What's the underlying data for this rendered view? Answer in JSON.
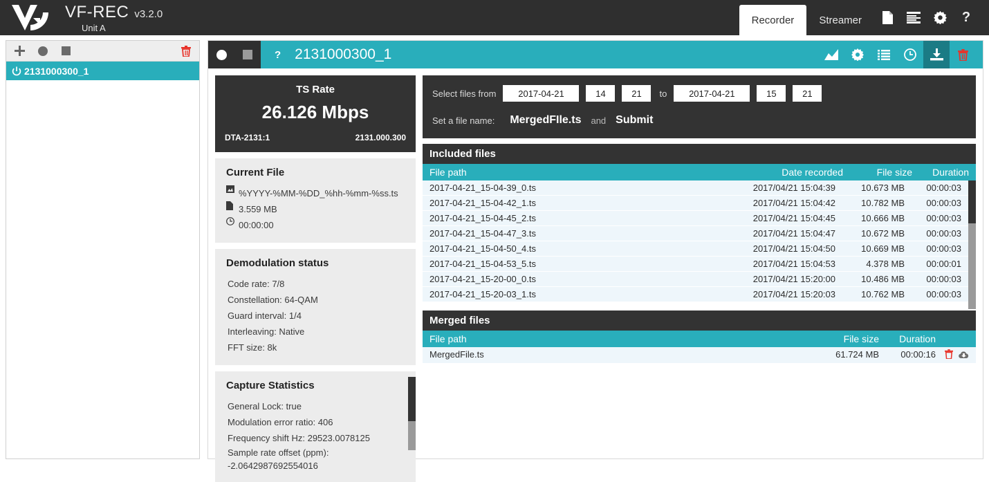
{
  "header": {
    "logo_icon": "va-logo-icon",
    "app_name": "VF-REC",
    "version": "v3.2.0",
    "unit": "Unit A",
    "tabs": [
      {
        "label": "Recorder",
        "active": true
      },
      {
        "label": "Streamer",
        "active": false
      }
    ],
    "icons": [
      {
        "name": "document-icon",
        "glyph": "📄"
      },
      {
        "name": "logs-icon",
        "glyph": "☰"
      },
      {
        "name": "gear-icon",
        "glyph": "⚙"
      },
      {
        "name": "help-icon",
        "glyph": "?"
      }
    ]
  },
  "sidebar": {
    "toolbar": [
      {
        "name": "add-channel-button",
        "glyph": "+"
      },
      {
        "name": "record-button",
        "glyph": "●"
      },
      {
        "name": "stop-button",
        "glyph": "■"
      }
    ],
    "delete_label": "delete-channel-button",
    "channels": [
      {
        "label": "2131000300_1",
        "selected": true
      }
    ]
  },
  "panel_header": {
    "record_icon": "record-icon",
    "stop_icon": "stop-icon",
    "help_label": "?",
    "title": "2131000300_1",
    "icons": [
      {
        "name": "chart-icon",
        "glyph": "Ὄ8",
        "active": false
      },
      {
        "name": "gear-icon",
        "glyph": "⚙",
        "active": false
      },
      {
        "name": "list-icon",
        "glyph": "☰",
        "active": false
      },
      {
        "name": "clock-icon",
        "glyph": "◴",
        "active": false
      },
      {
        "name": "download-icon",
        "glyph": "⬇",
        "active": true
      },
      {
        "name": "trash-icon",
        "glyph": "🗑",
        "active": false
      }
    ]
  },
  "ts_rate": {
    "title": "TS Rate",
    "value": "26.126 Mbps",
    "device": "DTA-2131:1",
    "serial": "2131.000.300"
  },
  "current_file": {
    "title": "Current File",
    "name": "%YYYY-%MM-%DD_%hh-%mm-%ss.ts",
    "size": "3.559 MB",
    "duration": "00:00:00"
  },
  "demodulation": {
    "title": "Demodulation status",
    "lines": [
      "Code rate: 7/8",
      "Constellation: 64-QAM",
      "Guard interval: 1/4",
      "Interleaving: Native",
      "FFT size: 8k"
    ]
  },
  "capture_statistics": {
    "title": "Capture Statistics",
    "lines": [
      "General Lock: true",
      "Modulation error ratio: 406",
      "Frequency shift Hz: 29523.0078125",
      "Sample rate offset (ppm): -2.0642987692554016"
    ]
  },
  "merge": {
    "from_label": "Select files from",
    "from_date": "2017-04-21",
    "from_hour": "14",
    "from_min": "21",
    "to_label": "to",
    "to_date": "2017-04-21",
    "to_hour": "15",
    "to_min": "21",
    "filename_label": "Set a file name:",
    "filename_value": "MergedFIle.ts",
    "and_label": "and",
    "submit_label": "Submit"
  },
  "included_files": {
    "title": "Included files",
    "columns": [
      "File path",
      "Date recorded",
      "File size",
      "Duration"
    ],
    "rows": [
      {
        "path": "2017-04-21_15-04-39_0.ts",
        "date": "2017/04/21 15:04:39",
        "size": "10.673 MB",
        "duration": "00:00:03"
      },
      {
        "path": "2017-04-21_15-04-42_1.ts",
        "date": "2017/04/21 15:04:42",
        "size": "10.782 MB",
        "duration": "00:00:03"
      },
      {
        "path": "2017-04-21_15-04-45_2.ts",
        "date": "2017/04/21 15:04:45",
        "size": "10.666 MB",
        "duration": "00:00:03"
      },
      {
        "path": "2017-04-21_15-04-47_3.ts",
        "date": "2017/04/21 15:04:47",
        "size": "10.672 MB",
        "duration": "00:00:03"
      },
      {
        "path": "2017-04-21_15-04-50_4.ts",
        "date": "2017/04/21 15:04:50",
        "size": "10.669 MB",
        "duration": "00:00:03"
      },
      {
        "path": "2017-04-21_15-04-53_5.ts",
        "date": "2017/04/21 15:04:53",
        "size": "4.378 MB",
        "duration": "00:00:01"
      },
      {
        "path": "2017-04-21_15-20-00_0.ts",
        "date": "2017/04/21 15:20:00",
        "size": "10.486 MB",
        "duration": "00:00:03"
      },
      {
        "path": "2017-04-21_15-20-03_1.ts",
        "date": "2017/04/21 15:20:03",
        "size": "10.762 MB",
        "duration": "00:00:03"
      }
    ]
  },
  "merged_files": {
    "title": "Merged files",
    "columns": [
      "File path",
      "File size",
      "Duration"
    ],
    "rows": [
      {
        "path": "MergedFile.ts",
        "size": "61.724 MB",
        "duration": "00:00:16"
      }
    ]
  },
  "colors": {
    "accent": "#29aebb",
    "accent_dark": "#1b7b85",
    "dark": "#2f2f2f",
    "panel_dark": "#333333",
    "row_bg": "#eef6fb",
    "danger": "#e8332a"
  }
}
